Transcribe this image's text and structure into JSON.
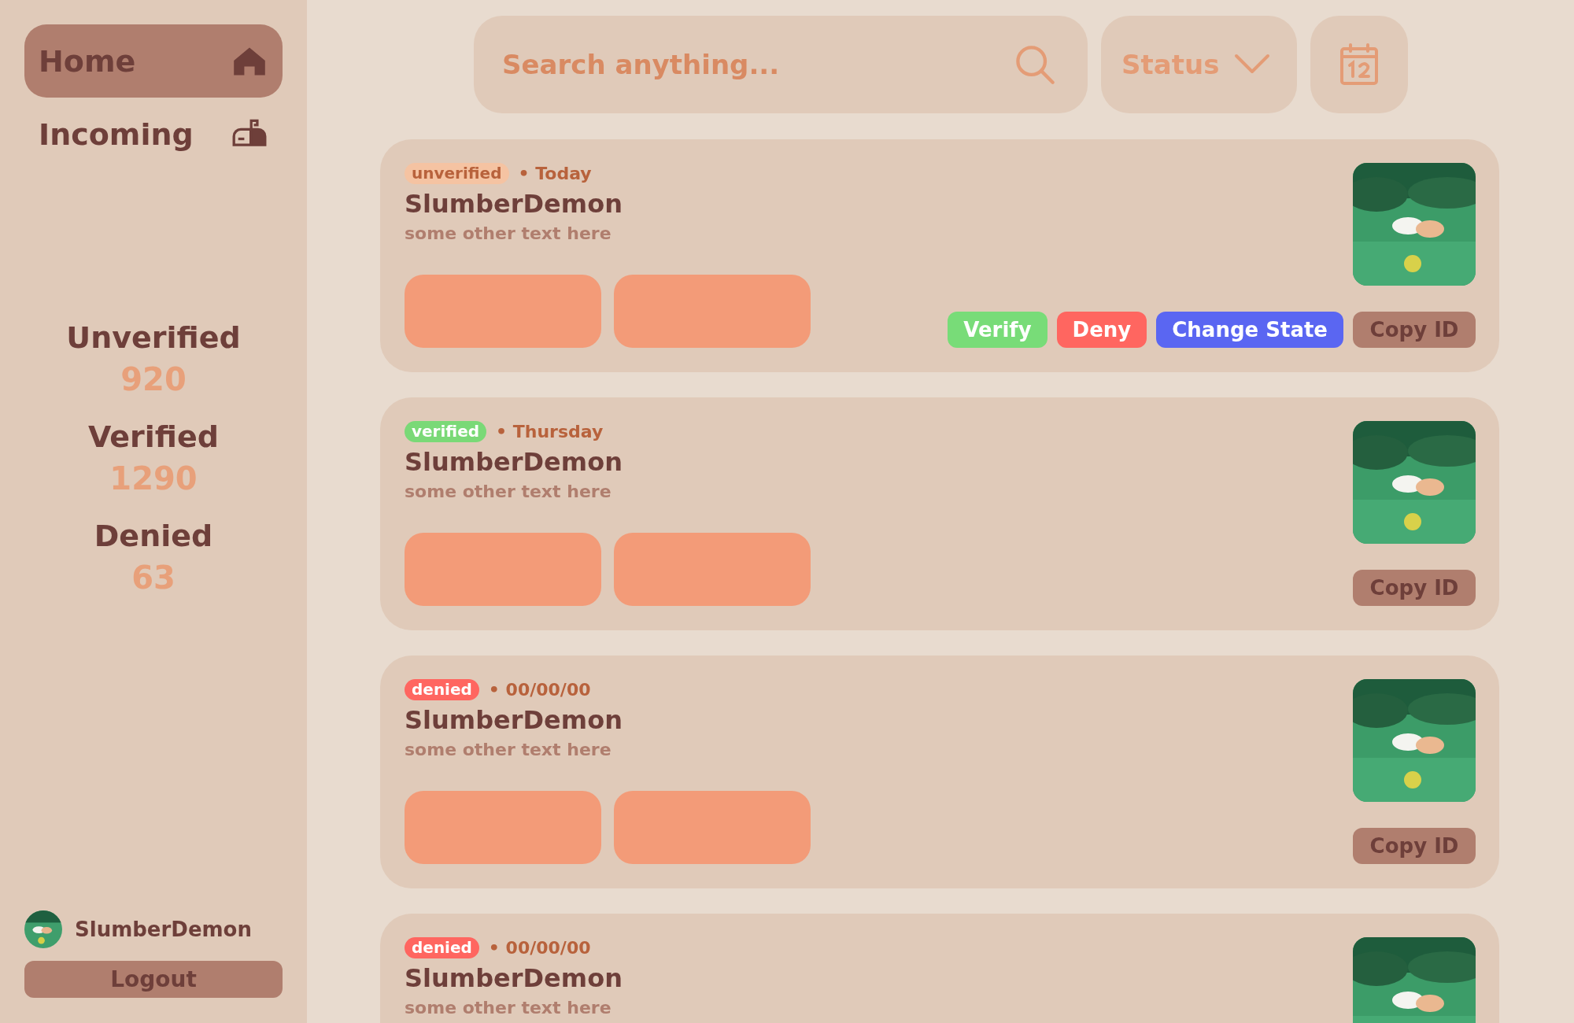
{
  "sidebar": {
    "nav": [
      {
        "label": "Home",
        "selected": true
      },
      {
        "label": "Incoming",
        "selected": false
      }
    ],
    "stats": [
      {
        "label": "Unverified",
        "value": "920"
      },
      {
        "label": "Verified",
        "value": "1290"
      },
      {
        "label": "Denied",
        "value": "63"
      }
    ],
    "user": {
      "name": "SlumberDemon"
    },
    "logout": "Logout"
  },
  "search": {
    "placeholder": "Search anything..."
  },
  "status_filter": {
    "label": "Status"
  },
  "cards": [
    {
      "status": {
        "kind": "unverified",
        "label": "unverified"
      },
      "date": "• Today",
      "title": "SlumberDemon",
      "subtitle": "some other text here",
      "actions": [
        {
          "kind": "verify",
          "label": "Verify"
        },
        {
          "kind": "deny",
          "label": "Deny"
        },
        {
          "kind": "change",
          "label": "Change State"
        },
        {
          "kind": "copy",
          "label": "Copy ID"
        }
      ]
    },
    {
      "status": {
        "kind": "verified",
        "label": "verified"
      },
      "date": "• Thursday",
      "title": "SlumberDemon",
      "subtitle": "some other text here",
      "actions": [
        {
          "kind": "copy",
          "label": "Copy ID"
        }
      ]
    },
    {
      "status": {
        "kind": "denied",
        "label": "denied"
      },
      "date": "• 00/00/00",
      "title": "SlumberDemon",
      "subtitle": "some other text here",
      "actions": [
        {
          "kind": "copy",
          "label": "Copy ID"
        }
      ]
    },
    {
      "status": {
        "kind": "denied",
        "label": "denied"
      },
      "date": "• 00/00/00",
      "title": "SlumberDemon",
      "subtitle": "some other text here"
    }
  ]
}
